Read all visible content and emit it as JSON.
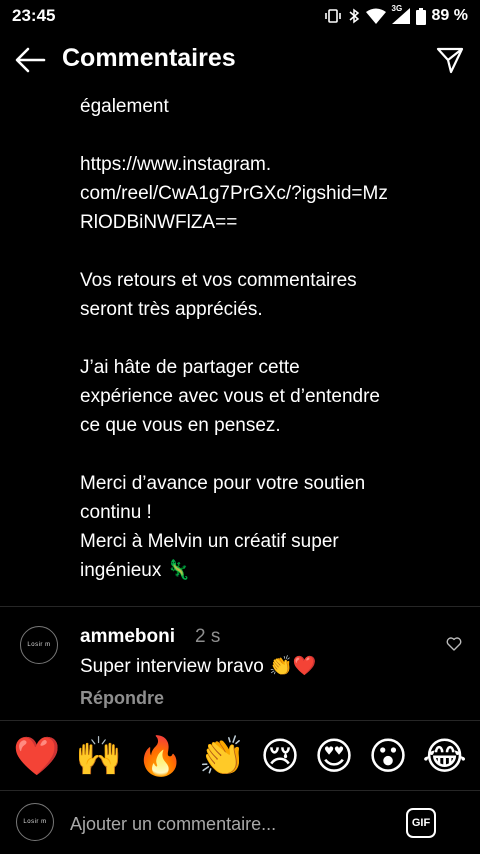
{
  "status_bar": {
    "time": "23:45",
    "network": "3G",
    "battery": "89 %"
  },
  "app_bar": {
    "title": "Commentaires"
  },
  "post": {
    "body": "également\n\nhttps://www.instagram.\ncom/reel/CwA1g7PrGXc/?igshid=Mz\nRlODBiNWFlZA==\n\nVos retours et vos commentaires\nseront très appréciés.\n\nJ’ai hâte de partager cette\nexpérience avec vous et d’entendre\nce que vous en pensez.\n\nMerci d’avance pour votre soutien\ncontinu !\nMerci à Melvin un créatif super\ningénieux 🦎"
  },
  "comment": {
    "username": "ammeboni",
    "time": "2 s",
    "text": "Super interview bravo 👏❤️",
    "reply_label": "Répondre",
    "avatar_text": "Losir m"
  },
  "emoji_bar": [
    "❤️",
    "🙌",
    "🔥",
    "👏",
    "😢",
    "😍",
    "😮",
    "😂"
  ],
  "composer": {
    "placeholder": "Ajouter un commentaire...",
    "gif_label": "GIF",
    "avatar_text": "Losir m"
  },
  "colors": {
    "background": "#000000",
    "secondary_text": "#8e8e8e",
    "divider": "#262626"
  }
}
